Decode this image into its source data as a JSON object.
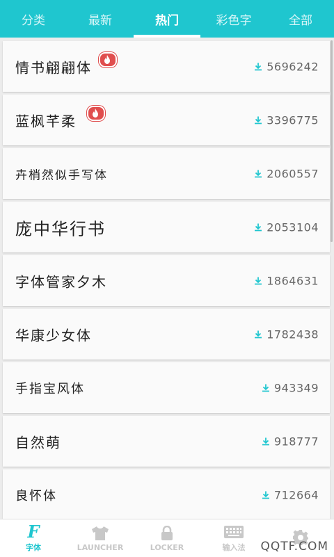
{
  "tabs": [
    {
      "label": "分类"
    },
    {
      "label": "最新"
    },
    {
      "label": "热门"
    },
    {
      "label": "彩色字"
    },
    {
      "label": "全部"
    }
  ],
  "active_tab": "热门",
  "fonts": [
    {
      "name": "情书翩翩体",
      "downloads": "5696242",
      "hot": true
    },
    {
      "name": "蓝枫芊柔",
      "downloads": "3396775",
      "hot": true
    },
    {
      "name": "卉梢然似手写体",
      "downloads": "2060557",
      "hot": false
    },
    {
      "name": "庞中华行书",
      "downloads": "2053104",
      "hot": false
    },
    {
      "name": "字体管家夕木",
      "downloads": "1864631",
      "hot": false
    },
    {
      "name": "华康少女体",
      "downloads": "1782438",
      "hot": false
    },
    {
      "name": "手指宝风体",
      "downloads": "943349",
      "hot": false
    },
    {
      "name": "自然萌",
      "downloads": "918777",
      "hot": false
    },
    {
      "name": "良怀体",
      "downloads": "712664",
      "hot": false
    }
  ],
  "bottom_nav": [
    {
      "label": "字体",
      "icon": "font-f-icon",
      "active": true
    },
    {
      "label": "LAUNCHER",
      "icon": "shirt-icon",
      "active": false
    },
    {
      "label": "LOCKER",
      "icon": "lock-icon",
      "active": false
    },
    {
      "label": "输入法",
      "icon": "keyboard-icon",
      "active": false
    },
    {
      "label": "",
      "icon": "gear-icon",
      "active": false
    }
  ],
  "watermark": "QQTF.COM",
  "colors": {
    "accent": "#1fc6cf",
    "hot_badge": "#e04e4e",
    "download_icon": "#1fc6cf"
  }
}
